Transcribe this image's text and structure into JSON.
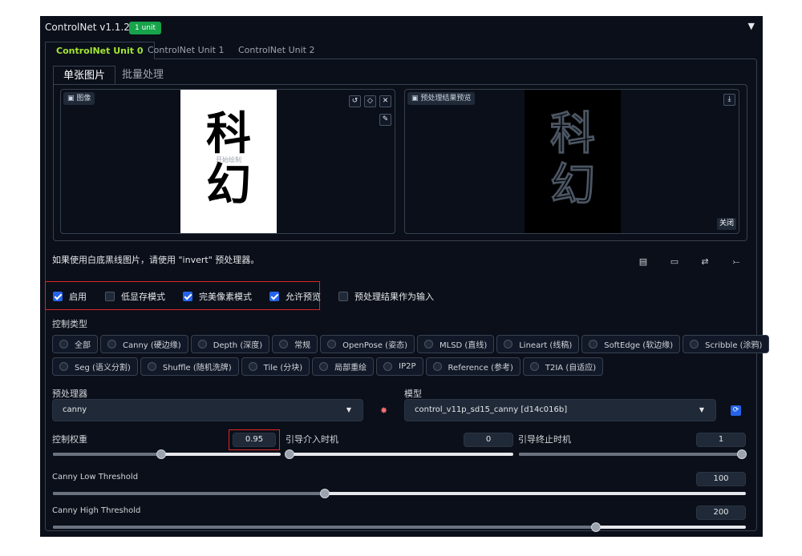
{
  "header": {
    "title": "ControlNet v1.1.224",
    "badge": "1 unit",
    "collapse_glyph": "▼"
  },
  "unit_tabs": [
    "ControlNet Unit 0",
    "ControlNet Unit 1",
    "ControlNet Unit 2"
  ],
  "image_tabs": [
    "单张图片",
    "批量处理"
  ],
  "input_image": {
    "label": "图像",
    "label_icon": "image-icon",
    "chars": [
      "科",
      "幻"
    ],
    "watermark": "开始绘制",
    "tools": [
      "undo-icon",
      "eraser-icon",
      "close-icon",
      "brush-icon"
    ]
  },
  "preview_image": {
    "label": "预处理结果预览",
    "label_icon": "image-icon",
    "chars": [
      "科",
      "幻"
    ],
    "close_label": "关闭",
    "tools": [
      "download-icon"
    ]
  },
  "hint": "如果使用白底黑线图片，请使用 \"invert\" 预处理器。",
  "action_icons": [
    "new-doc-icon",
    "camera-icon",
    "swap-icon",
    "send-dimensions-icon"
  ],
  "checkboxes": [
    {
      "label": "启用",
      "checked": true
    },
    {
      "label": "低显存模式",
      "checked": false
    },
    {
      "label": "完美像素模式",
      "checked": true
    },
    {
      "label": "允许预览",
      "checked": true
    },
    {
      "label": "预处理结果作为输入",
      "checked": false
    }
  ],
  "control_type": {
    "label": "控制类型",
    "row1": [
      "全部",
      "Canny (硬边缘)",
      "Depth (深度)",
      "常规",
      "OpenPose (姿态)",
      "MLSD (直线)",
      "Lineart (线稿)",
      "SoftEdge (软边缘)",
      "Scribble (涂鸦)"
    ],
    "row2": [
      "Seg (语义分割)",
      "Shuffle (随机洗牌)",
      "Tile (分块)",
      "局部重绘",
      "IP2P",
      "Reference (参考)",
      "T2IA (自适应)"
    ]
  },
  "preprocessor": {
    "label": "预处理器",
    "value": "canny"
  },
  "model": {
    "label": "模型",
    "value": "control_v11p_sd15_canny [d14c016b]"
  },
  "sliders": {
    "weight": {
      "label": "控制权重",
      "value": "0.95",
      "fraction": 0.475
    },
    "guidance_start": {
      "label": "引导介入时机",
      "value": "0",
      "fraction": 0.0
    },
    "guidance_end": {
      "label": "引导终止时机",
      "value": "1",
      "fraction": 1.0
    },
    "low_threshold": {
      "label": "Canny Low Threshold",
      "value": "100",
      "fraction": 0.392
    },
    "high_threshold": {
      "label": "Canny High Threshold",
      "value": "200",
      "fraction": 0.784
    }
  },
  "colors": {
    "accent_green": "#a3e635",
    "badge_green": "#16a34a",
    "check_blue": "#2563eb",
    "highlight_red": "#dc2626",
    "panel_bg": "#0b0f19"
  }
}
